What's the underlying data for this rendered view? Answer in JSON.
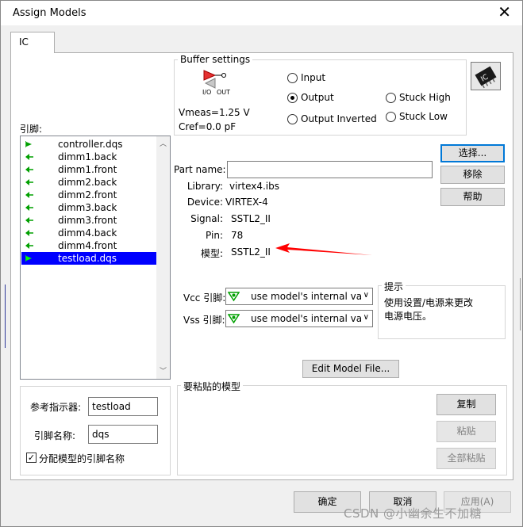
{
  "window": {
    "title": "Assign Models",
    "close_glyph": "✕"
  },
  "tabs": [
    {
      "label": "IC",
      "active": true
    }
  ],
  "pins": {
    "label": "引脚:",
    "items": [
      {
        "name": "controller.dqs",
        "direction": "output",
        "selected": false
      },
      {
        "name": "dimm1.back",
        "direction": "input",
        "selected": false
      },
      {
        "name": "dimm1.front",
        "direction": "input",
        "selected": false
      },
      {
        "name": "dimm2.back",
        "direction": "input",
        "selected": false
      },
      {
        "name": "dimm2.front",
        "direction": "input",
        "selected": false
      },
      {
        "name": "dimm3.back",
        "direction": "input",
        "selected": false
      },
      {
        "name": "dimm3.front",
        "direction": "input",
        "selected": false
      },
      {
        "name": "dimm4.back",
        "direction": "input",
        "selected": false
      },
      {
        "name": "dimm4.front",
        "direction": "input",
        "selected": false
      },
      {
        "name": "testload.dqs",
        "direction": "output",
        "selected": true
      }
    ]
  },
  "buffer_settings": {
    "title": "Buffer settings",
    "io_label": "I/O",
    "out_label": "OUT",
    "vmeas": "Vmeas=1.25 V",
    "cref": "Cref=0.0 pF",
    "radios": [
      {
        "label": "Input",
        "checked": false
      },
      {
        "label": "Output",
        "checked": true
      },
      {
        "label": "Output Inverted",
        "checked": false
      },
      {
        "label": "Stuck High",
        "checked": false
      },
      {
        "label": "Stuck Low",
        "checked": false
      }
    ]
  },
  "ic_icon": "ic-chip-icon",
  "model_info": {
    "part_name_label": "Part name:",
    "part_name_value": "",
    "library_label": "Library:",
    "library_value": "virtex4.ibs",
    "device_label": "Device:",
    "device_value": "VIRTEX-4",
    "signal_label": "Signal:",
    "signal_value": "SSTL2_II",
    "pin_label": "Pin:",
    "pin_value": "78",
    "model_label": "模型:",
    "model_value": "SSTL2_II"
  },
  "side_buttons": {
    "select": "选择...",
    "remove": "移除",
    "help": "帮助"
  },
  "supply": {
    "vcc_label": "Vcc 引脚:",
    "vcc_value": "use model's internal va",
    "vss_label": "Vss 引脚:",
    "vss_value": "use model's internal va"
  },
  "hint": {
    "title": "提示",
    "text": "使用设置/电源来更改电源电压。",
    "line1": "使用设置/电源来更改",
    "line2": "电源电压。"
  },
  "edit_model_button": "Edit Model File...",
  "reference": {
    "ref_label": "参考指示器:",
    "ref_value": "testload",
    "pin_name_label": "引脚名称:",
    "pin_name_value": "dqs",
    "assign_checkbox_label": "分配模型的引脚名称",
    "assign_checked": true
  },
  "paste_group": {
    "title": "要粘贴的模型",
    "copy": "复制",
    "paste": "粘贴",
    "paste_all": "全部粘贴"
  },
  "footer": {
    "ok": "确定",
    "cancel": "取消",
    "apply": "应用(A)"
  },
  "watermark": "CSDN @小幽余生不加糖",
  "colors": {
    "selection": "#0000ff",
    "pin_arrow": "#00a000",
    "annotation_arrow": "#ff0000"
  }
}
